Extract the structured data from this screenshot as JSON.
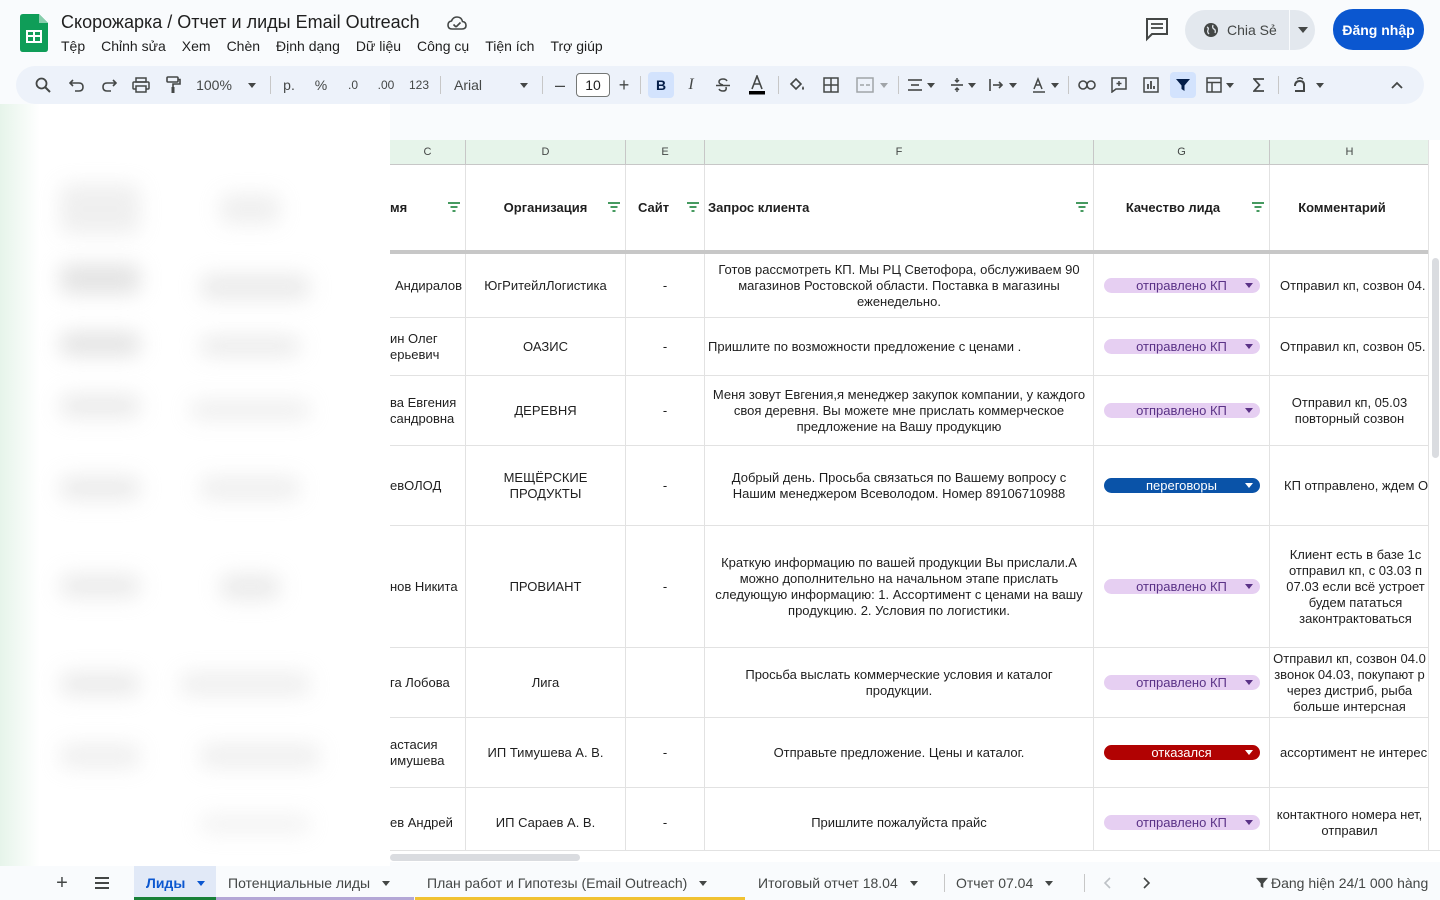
{
  "header": {
    "title": "Скорожарка / Отчет и лиды Email Outreach",
    "menu": [
      "Tệp",
      "Chỉnh sửa",
      "Xem",
      "Chèn",
      "Định dạng",
      "Dữ liệu",
      "Công cụ",
      "Tiện ích",
      "Trợ giúp"
    ],
    "share_label": "Chia Sẻ",
    "login_label": "Đăng nhập"
  },
  "toolbar": {
    "zoom": "100%",
    "currency": "р.",
    "percent": "%",
    "decrease_decimals": ".0",
    "increase_decimals": ".00",
    "number_format": "123",
    "font": "Arial",
    "font_size": "10",
    "bold": "B",
    "italic": "I"
  },
  "grid": {
    "columns": [
      {
        "letter": "C",
        "title": "мя"
      },
      {
        "letter": "D",
        "title": "Организация"
      },
      {
        "letter": "E",
        "title": "Сайт"
      },
      {
        "letter": "F",
        "title": "Запрос клиента"
      },
      {
        "letter": "G",
        "title": "Качество лида"
      },
      {
        "letter": "H",
        "title": "Комментарий"
      }
    ],
    "rows": [
      {
        "name": "Андиралов",
        "org": "ЮгРитейлЛогистика",
        "site": "-",
        "request": "Готов рассмотреть КП. Мы РЦ Светофора, обслуживаем 90 магазинов Ростовской области. Поставка в магазины еженедельно.",
        "quality": "отправлено КП",
        "comment": "Отправил кп, созвон 04."
      },
      {
        "name": "ин Олег ерьевич",
        "org": "ОАЗИС",
        "site": "-",
        "request": "Пришлите по возможности предложение с ценами .",
        "quality": "отправлено КП",
        "comment": "Отправил кп, созвон 05."
      },
      {
        "name": "ва Евгения сандровна",
        "org": "ДЕРЕВНЯ",
        "site": "-",
        "request": "Меня зовут Евгения,я менеджер закупок компании, у каждого своя деревня. Вы можете мне прислать коммерческое предложение на Вашу продукцию",
        "quality": "отправлено КП",
        "comment": "Отправил кп, 05.03 повторный созвон"
      },
      {
        "name": "евОЛОД",
        "org": "МЕЩЁРСКИЕ ПРОДУКТЫ",
        "site": "-",
        "request": "Добрый день. Просьба связаться по Вашему вопросу с Нашим менеджером Всеволодом. Номер 89106710988",
        "quality": "переговоры",
        "comment": "КП отправлено, ждем О"
      },
      {
        "name": "нов Никита",
        "org": "ПРОВИАНТ",
        "site": "-",
        "request": "Краткую информацию по вашей продукции Вы прислали.А можно дополнительно на начальном этапе прислать следующую информацию:  1. Ассортимент с ценами на вашу продукцию. 2. Условия по логистики.",
        "quality": "отправлено КП",
        "comment": "Клиент есть в базе 1с отправил кп, с 03.03 п 07.03 если всё устроет будем пататься законтрактоваться"
      },
      {
        "name": "га Лобова",
        "org": "Лига",
        "site": "",
        "request": "Просьба выслать коммерческие условия и каталог продукции.",
        "quality": "отправлено КП",
        "comment": "Отправил кп, созвон 04.0 звонок 04.03, покупают р через дистриб, рыба больше интерсная"
      },
      {
        "name": "астасия имушева",
        "org": "ИП Тимушева А. В.",
        "site": "-",
        "request": "Отправьте предложение. Цены и каталог.",
        "quality": "отказался",
        "comment": "ассортимент не интерес"
      },
      {
        "name": "ев Андрей",
        "org": "ИП Сараев А. В.",
        "site": "-",
        "request": "Пришлите пожалуйста прайс",
        "quality": "отправлено КП",
        "comment": "контактного номера нет, отправил"
      }
    ]
  },
  "tabs": [
    {
      "label": "Лиды",
      "color": "#188038"
    },
    {
      "label": "Потенциальные лиды",
      "color": "#b4a7d6"
    },
    {
      "label": "План работ и Гипотезы (Email Outreach)",
      "color": "#f1c232"
    },
    {
      "label": "Итоговый отчет 18.04",
      "color": ""
    },
    {
      "label": "Отчет 07.04",
      "color": ""
    }
  ],
  "status_text": "Đang hiện 24/1 000 hàng",
  "colors": {
    "sent_chip": "#e6cff2",
    "negotiation_chip": "#0a53a8",
    "refused_chip": "#b10202",
    "accent": "#0b57d0"
  }
}
